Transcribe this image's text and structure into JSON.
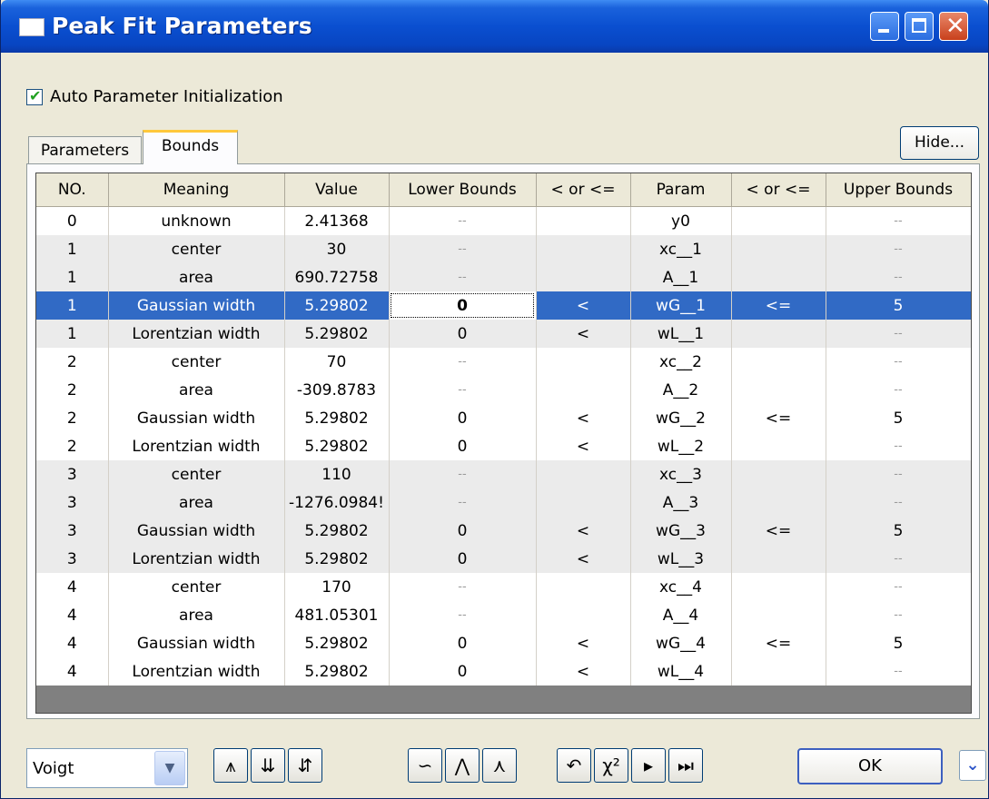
{
  "window": {
    "title": "Peak Fit Parameters"
  },
  "auto_init": {
    "label": "Auto Parameter Initialization",
    "checked": true
  },
  "tabs": [
    {
      "label": "Parameters"
    },
    {
      "label": "Bounds"
    }
  ],
  "hide_label": "Hide...",
  "table": {
    "headers": [
      "NO.",
      "Meaning",
      "Value",
      "Lower Bounds",
      "< or <=",
      "Param",
      "< or <=",
      "Upper Bounds"
    ],
    "rows": [
      [
        "0",
        "unknown",
        "2.41368",
        "",
        "",
        "y0",
        "",
        ""
      ],
      [
        "1",
        "center",
        "30",
        "",
        "",
        "xc__1",
        "",
        ""
      ],
      [
        "1",
        "area",
        "690.72758",
        "",
        "",
        "A__1",
        "",
        ""
      ],
      [
        "1",
        "Gaussian width",
        "5.29802",
        "0",
        "<",
        "wG__1",
        "<=",
        "5"
      ],
      [
        "1",
        "Lorentzian width",
        "5.29802",
        "0",
        "<",
        "wL__1",
        "",
        ""
      ],
      [
        "2",
        "center",
        "70",
        "",
        "",
        "xc__2",
        "",
        ""
      ],
      [
        "2",
        "area",
        "-309.8783",
        "",
        "",
        "A__2",
        "",
        ""
      ],
      [
        "2",
        "Gaussian width",
        "5.29802",
        "0",
        "<",
        "wG__2",
        "<=",
        "5"
      ],
      [
        "2",
        "Lorentzian width",
        "5.29802",
        "0",
        "<",
        "wL__2",
        "",
        ""
      ],
      [
        "3",
        "center",
        "110",
        "",
        "",
        "xc__3",
        "",
        ""
      ],
      [
        "3",
        "area",
        "-1276.0984!",
        "",
        "",
        "A__3",
        "",
        ""
      ],
      [
        "3",
        "Gaussian width",
        "5.29802",
        "0",
        "<",
        "wG__3",
        "<=",
        "5"
      ],
      [
        "3",
        "Lorentzian width",
        "5.29802",
        "0",
        "<",
        "wL__3",
        "",
        ""
      ],
      [
        "4",
        "center",
        "170",
        "",
        "",
        "xc__4",
        "",
        ""
      ],
      [
        "4",
        "area",
        "481.05301",
        "",
        "",
        "A__4",
        "",
        ""
      ],
      [
        "4",
        "Gaussian width",
        "5.29802",
        "0",
        "<",
        "wG__4",
        "<=",
        "5"
      ],
      [
        "4",
        "Lorentzian width",
        "5.29802",
        "0",
        "<",
        "wL__4",
        "",
        ""
      ]
    ],
    "dash_text": "--"
  },
  "toolbar": {
    "function_select": "Voigt",
    "ok_label": "OK"
  }
}
